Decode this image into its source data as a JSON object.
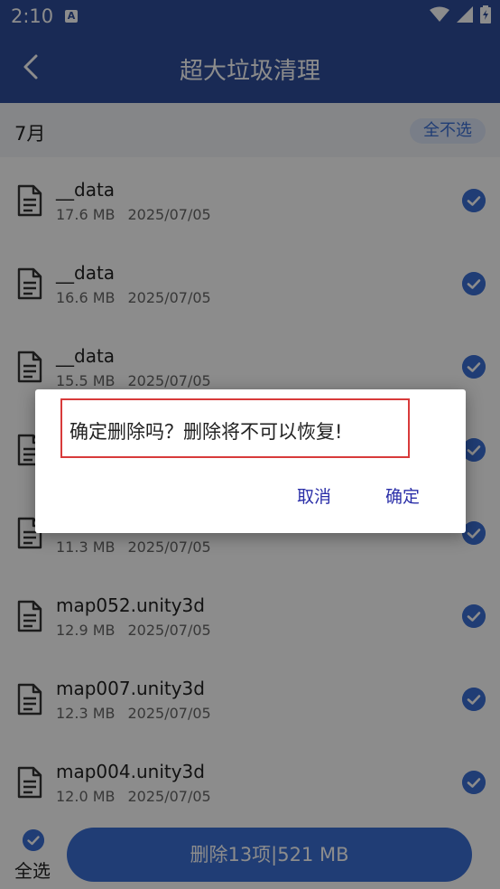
{
  "status_bar": {
    "time": "2:10",
    "notification_badge": "A"
  },
  "header": {
    "title": "超大垃圾清理"
  },
  "group": {
    "month": "7月",
    "deselect_all_label": "全不选"
  },
  "files": [
    {
      "name": "__data",
      "size": "17.6 MB",
      "date": "2025/07/05"
    },
    {
      "name": "__data",
      "size": "16.6 MB",
      "date": "2025/07/05"
    },
    {
      "name": "__data",
      "size": "15.5 MB",
      "date": "2025/07/05"
    },
    {
      "name": "",
      "size": "",
      "date": ""
    },
    {
      "name": "",
      "size": "11.3 MB",
      "date": "2025/07/05"
    },
    {
      "name": "map052.unity3d",
      "size": "12.9 MB",
      "date": "2025/07/05"
    },
    {
      "name": "map007.unity3d",
      "size": "12.3 MB",
      "date": "2025/07/05"
    },
    {
      "name": "map004.unity3d",
      "size": "12.0 MB",
      "date": "2025/07/05"
    }
  ],
  "bottom": {
    "select_all_label": "全选",
    "delete_label": "删除13项|521 MB"
  },
  "dialog": {
    "message": "确定删除吗？删除将不可以恢复!",
    "cancel_label": "取消",
    "confirm_label": "确定"
  },
  "colors": {
    "primary": "#2f4d9b",
    "accent": "#3b6fd6",
    "dialog_button": "#2b2fa8",
    "highlight": "#d83a3a"
  }
}
